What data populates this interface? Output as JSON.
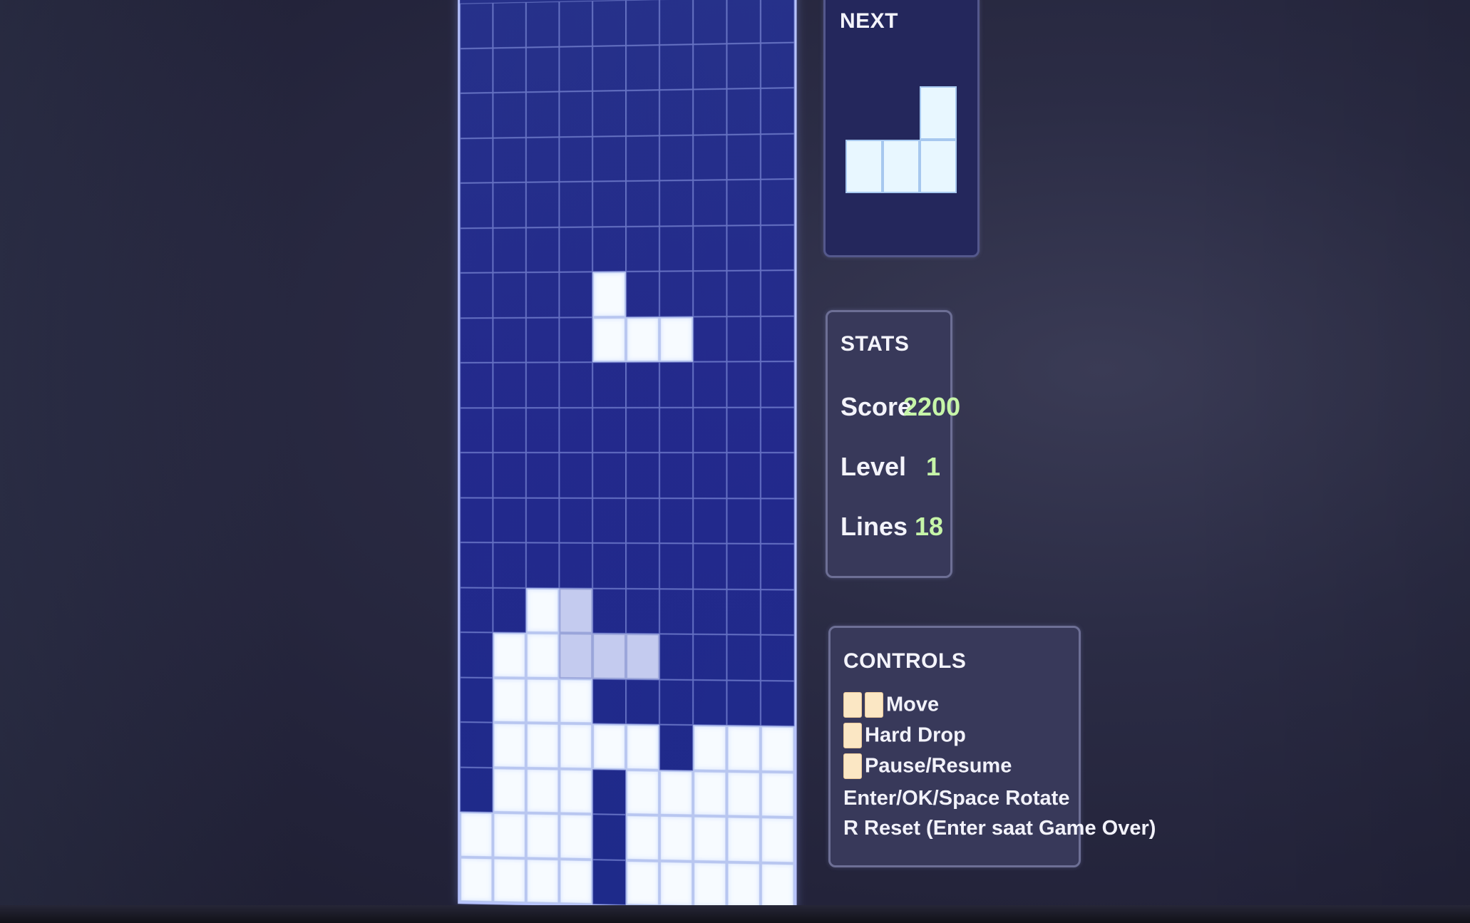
{
  "board": {
    "cols": 10,
    "rows": 22,
    "active_piece": [
      [
        0,
        4
      ],
      [
        1,
        4
      ],
      [
        1,
        5
      ],
      [
        1,
        6
      ]
    ],
    "ghost_piece": [
      [
        13,
        3
      ],
      [
        14,
        3
      ],
      [
        14,
        4
      ],
      [
        14,
        5
      ]
    ],
    "locked": [
      [
        13,
        2
      ],
      [
        14,
        1
      ],
      [
        14,
        2
      ],
      [
        15,
        1
      ],
      [
        15,
        2
      ],
      [
        15,
        3
      ],
      [
        16,
        1
      ],
      [
        16,
        2
      ],
      [
        16,
        3
      ],
      [
        16,
        4
      ],
      [
        16,
        5
      ],
      [
        16,
        7
      ],
      [
        16,
        8
      ],
      [
        16,
        9
      ],
      [
        17,
        1
      ],
      [
        17,
        2
      ],
      [
        17,
        3
      ],
      [
        17,
        5
      ],
      [
        17,
        6
      ],
      [
        17,
        7
      ],
      [
        17,
        8
      ],
      [
        17,
        9
      ],
      [
        18,
        0
      ],
      [
        18,
        1
      ],
      [
        18,
        2
      ],
      [
        18,
        3
      ],
      [
        18,
        5
      ],
      [
        18,
        6
      ],
      [
        18,
        7
      ],
      [
        18,
        8
      ],
      [
        18,
        9
      ],
      [
        19,
        0
      ],
      [
        19,
        1
      ],
      [
        19,
        2
      ],
      [
        19,
        3
      ],
      [
        19,
        5
      ],
      [
        19,
        6
      ],
      [
        19,
        7
      ],
      [
        19,
        8
      ],
      [
        19,
        9
      ]
    ],
    "visible_top_row": 6
  },
  "next": {
    "title": "NEXT",
    "piece": [
      [
        0,
        2
      ],
      [
        1,
        0
      ],
      [
        1,
        1
      ],
      [
        1,
        2
      ]
    ]
  },
  "stats": {
    "title": "STATS",
    "score_label": "Score",
    "score_value": "2200",
    "level_label": "Level",
    "level_value": "1",
    "lines_label": "Lines",
    "lines_value": "18"
  },
  "controls": {
    "title": "CONTROLS",
    "move": "Move",
    "hard_drop": "Hard Drop",
    "pause": "Pause/Resume",
    "rotate": "Enter/OK/Space Rotate",
    "reset": "R Reset (Enter saat Game Over)"
  },
  "colors": {
    "board_bg": "#23298c",
    "block": "#f7fbff",
    "ghost": "#c4cbef",
    "stat_value": "#c6f5a8",
    "key_cap": "#fbe7c4"
  }
}
